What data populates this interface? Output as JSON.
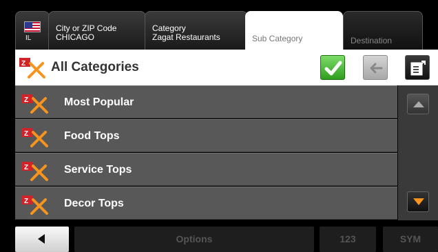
{
  "tabs": {
    "state_code": "IL",
    "city": {
      "label": "City or ZIP Code",
      "value": "CHICAGO"
    },
    "category": {
      "label": "Category",
      "value": "Zagat Restaurants"
    },
    "subcategory": {
      "label": "Sub Category"
    },
    "destination": {
      "label": "Destination"
    }
  },
  "header": {
    "title": "All Categories"
  },
  "list": {
    "items": [
      {
        "label": "Most Popular"
      },
      {
        "label": "Food Tops"
      },
      {
        "label": "Service Tops"
      },
      {
        "label": "Decor Tops"
      }
    ]
  },
  "bottom": {
    "options_label": "Options",
    "numbers_label": "123",
    "symbols_label": "SYM"
  },
  "colors": {
    "ok_green": "#2f9e1e",
    "zagat_red": "#d2232a",
    "scroll_arrow_orange": "#f7941d"
  },
  "icons": [
    "us-flag-icon",
    "zagat-category-icon",
    "check-icon",
    "back-arrow-icon",
    "export-icon",
    "scroll-up-icon",
    "scroll-down-icon",
    "back-triangle-icon"
  ]
}
